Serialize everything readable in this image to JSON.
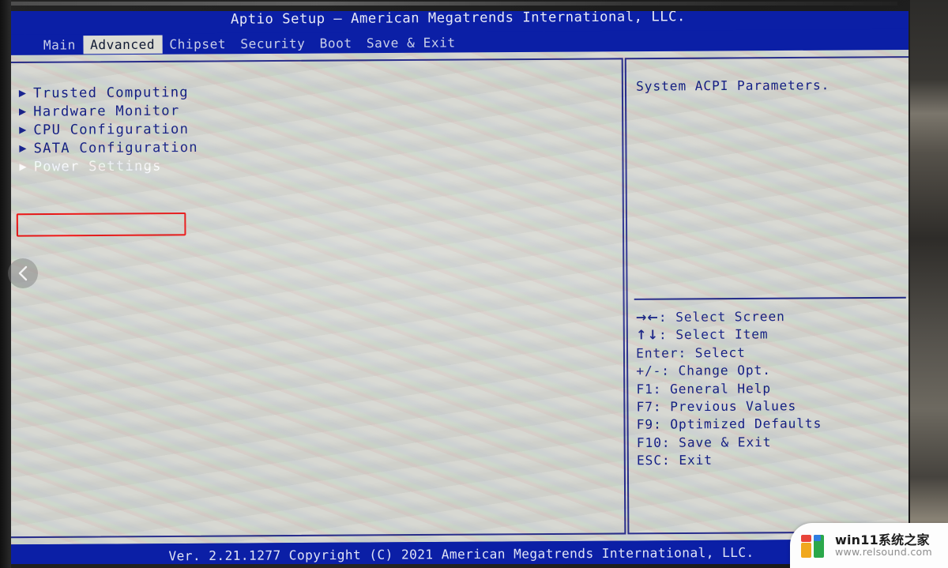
{
  "bios": {
    "title": "Aptio Setup – American Megatrends International, LLC.",
    "tabs": [
      {
        "label": "Main",
        "active": false
      },
      {
        "label": "Advanced",
        "active": true
      },
      {
        "label": "Chipset",
        "active": false
      },
      {
        "label": "Security",
        "active": false
      },
      {
        "label": "Boot",
        "active": false
      },
      {
        "label": "Save & Exit",
        "active": false
      }
    ],
    "menu_items": [
      {
        "label": "Trusted Computing",
        "arrow": "▶",
        "selected": false,
        "annotated": false
      },
      {
        "label": "Hardware Monitor",
        "arrow": "▶",
        "selected": false,
        "annotated": false
      },
      {
        "label": "CPU Configuration",
        "arrow": "▶",
        "selected": false,
        "annotated": false
      },
      {
        "label": "SATA Configuration",
        "arrow": "▶",
        "selected": false,
        "annotated": false
      },
      {
        "label": "Power Settings",
        "arrow": "▶",
        "selected": true,
        "annotated": true
      }
    ],
    "help_text": "System ACPI Parameters.",
    "key_legend": [
      {
        "glyph": "→←",
        "text": ": Select Screen"
      },
      {
        "glyph": "↑↓",
        "text": ": Select Item"
      },
      {
        "glyph": "Enter",
        "text": ": Select"
      },
      {
        "glyph": "+/-",
        "text": ": Change Opt."
      },
      {
        "glyph": "F1",
        "text": ": General Help"
      },
      {
        "glyph": "F7",
        "text": ": Previous Values"
      },
      {
        "glyph": "F9",
        "text": ": Optimized Defaults"
      },
      {
        "glyph": "F10",
        "text": ": Save & Exit"
      },
      {
        "glyph": "ESC",
        "text": ": Exit"
      }
    ],
    "footer": "Ver. 2.21.1277 Copyright (C) 2021 American Megatrends International, LLC."
  },
  "overlay": {
    "back_icon": "chevron-left-icon"
  },
  "watermark": {
    "title": "win11系统之家",
    "url": "www.relsound.com",
    "logo_colors": [
      "#e8443a",
      "#f0a81e",
      "#2aa84a",
      "#2f7de1"
    ]
  },
  "colors": {
    "bios_blue": "#0b1fa6",
    "panel_bg": "#d7d8d2",
    "text_blue": "#141f86",
    "border_blue": "#2a2f8e",
    "annotation_red": "#ef1010",
    "tab_active_bg": "#dcdcd4"
  }
}
